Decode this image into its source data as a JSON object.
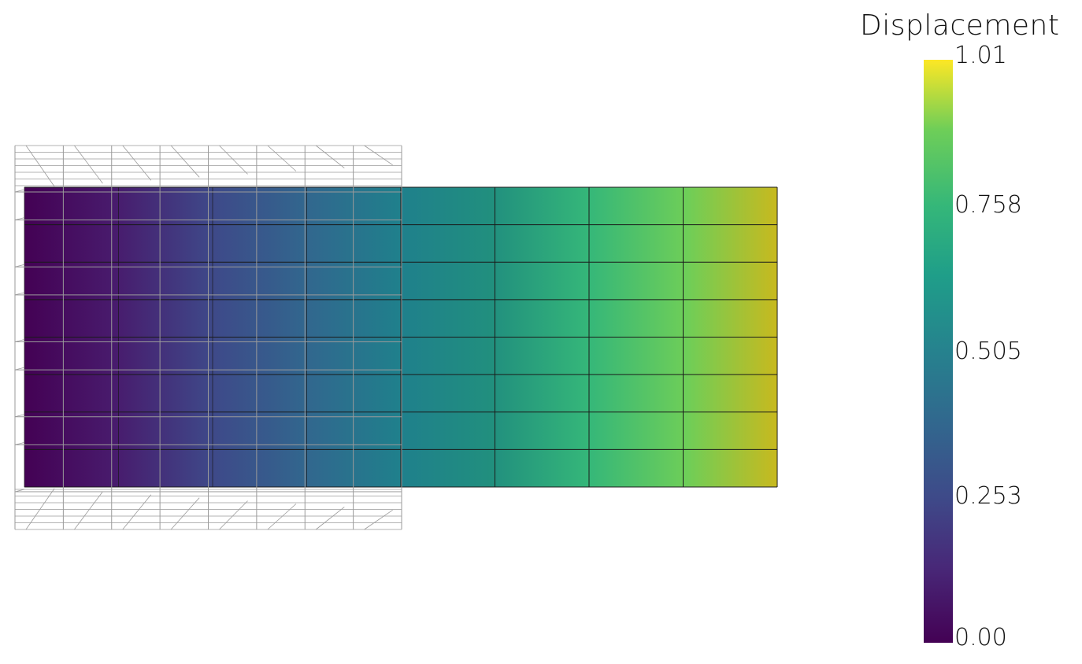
{
  "scene": {
    "mesh_columns": 8,
    "mesh_rows": 8,
    "wireframe_columns": 8,
    "wireframe_rows": 8,
    "scalar_min": 0.0,
    "scalar_max": 1.01
  },
  "legend": {
    "title": "Displacement",
    "ticks": [
      {
        "value": 1.01,
        "label": "1.01"
      },
      {
        "value": 0.758,
        "label": "0.758"
      },
      {
        "value": 0.505,
        "label": "0.505"
      },
      {
        "value": 0.253,
        "label": "0.253"
      },
      {
        "value": 0.0,
        "label": "0.00"
      }
    ],
    "colormap": "viridis",
    "colors": [
      "#440154",
      "#3b528b",
      "#21918c",
      "#5ec962",
      "#fde725"
    ]
  },
  "colors": {
    "wireframe": "#9a9a9a",
    "mesh_edge": "#1a1a1a",
    "background": "#ffffff"
  }
}
